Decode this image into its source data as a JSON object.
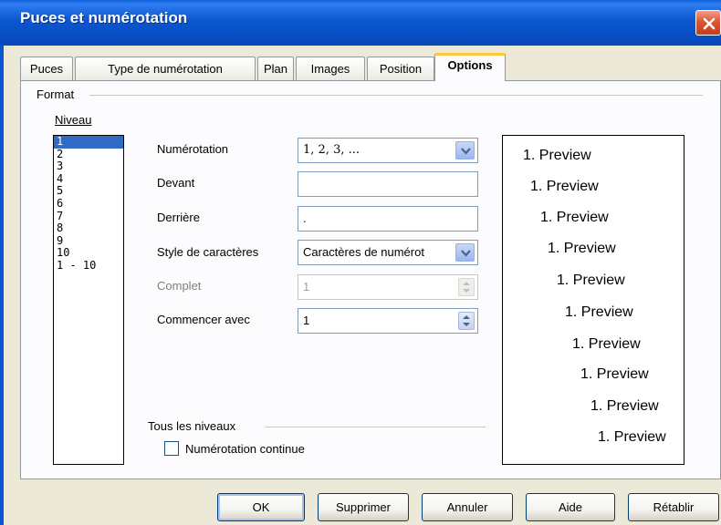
{
  "window": {
    "title": "Puces et numérotation"
  },
  "tabs": [
    {
      "label": "Puces"
    },
    {
      "label": "Type de numérotation"
    },
    {
      "label": "Plan"
    },
    {
      "label": "Images"
    },
    {
      "label": "Position"
    },
    {
      "label": "Options",
      "active": true
    }
  ],
  "format": {
    "group_label": "Format",
    "level_label": "Niveau",
    "levels": [
      "1",
      "2",
      "3",
      "4",
      "5",
      "6",
      "7",
      "8",
      "9",
      "10",
      "1 - 10"
    ],
    "selected_level": "1",
    "fields": {
      "numerotation": {
        "label": "Numérotation",
        "value": "1, 2, 3, ..."
      },
      "devant": {
        "label": "Devant",
        "value": ""
      },
      "derriere": {
        "label": "Derrière",
        "value": "."
      },
      "style": {
        "label": "Style de caractères",
        "value": "Caractères de numérot"
      },
      "complet": {
        "label": "Complet",
        "value": "1",
        "disabled": true
      },
      "commencer": {
        "label": "Commencer avec",
        "value": "1"
      }
    },
    "preview_lines": [
      "1. Preview",
      "1. Preview",
      "1. Preview",
      "1. Preview",
      "1. Preview",
      "1. Preview",
      "1. Preview",
      "1. Preview",
      "1. Preview",
      "1. Preview"
    ]
  },
  "all_levels": {
    "group_label": "Tous les niveaux",
    "continuous_label": "Numérotation continue",
    "continuous_checked": false
  },
  "buttons": {
    "ok": "OK",
    "delete": "Supprimer",
    "cancel": "Annuler",
    "help": "Aide",
    "reset": "Rétablir"
  },
  "colors": {
    "title_bar": "#0a56d0",
    "close_button": "#e0532f",
    "selection": "#316ac5",
    "active_tab_accent": "#ffc83c"
  },
  "icons": {
    "close": "close-icon",
    "dropdown": "chevron-down-icon",
    "spinner": "spinner-arrows-icon"
  }
}
